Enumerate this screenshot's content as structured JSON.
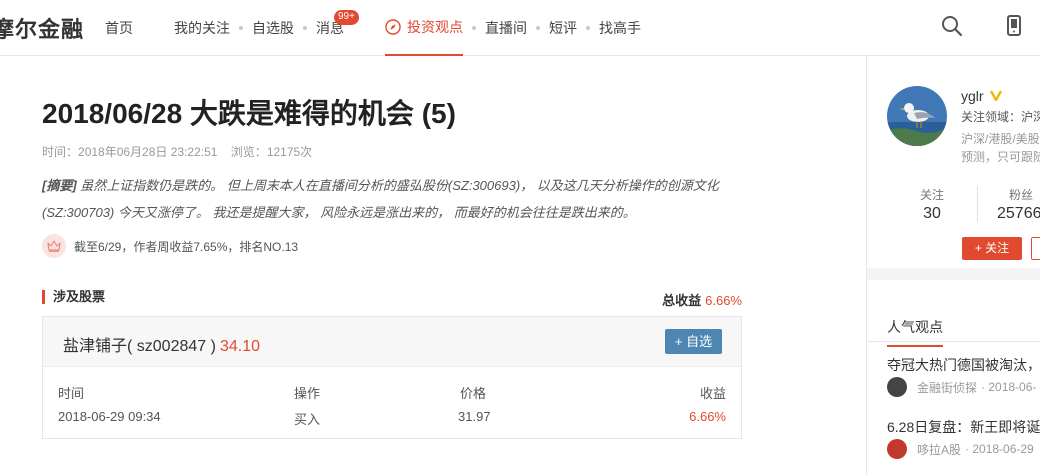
{
  "header": {
    "logo": "摩尔金融",
    "nav": [
      {
        "label": "首页",
        "active": false
      },
      {
        "label": "我的关注",
        "active": false
      },
      {
        "label": "自选股",
        "active": false
      },
      {
        "label": "消息",
        "active": false,
        "badge": "99+"
      },
      {
        "label": "投资观点",
        "active": true,
        "icon": "compass-icon"
      },
      {
        "label": "直播间",
        "active": false
      },
      {
        "label": "短评",
        "active": false
      },
      {
        "label": "找高手",
        "active": false
      }
    ],
    "icons": [
      "search-icon",
      "mobile-phone-icon"
    ]
  },
  "article": {
    "title": "2018/06/28 大跌是难得的机会 (5)",
    "time_label": "时间：",
    "time": "2018年06月28日 23:22:51",
    "views_label": "浏览：",
    "views": "12175次",
    "summary_tag": "[摘要]",
    "summary": " 虽然上证指数仍是跌的。 但上周末本人在直播间分析的盛弘股份(SZ:300693)， 以及这几天分析操作的创源文化(SZ:300703) 今天又涨停了。 我还是提醒大家， 风险永远是涨出来的， 而最好的机会往往是跌出来的。",
    "performance": "截至6/29，作者周收益7.65%，排名NO.13"
  },
  "stocks_section": {
    "title": "涉及股票",
    "total_label": "总收益",
    "total_value": "6.66%",
    "stock": {
      "name": "盐津铺子( sz002847 )",
      "price": "34.10",
      "add_label": "+ 自选"
    },
    "columns": [
      "时间",
      "操作",
      "价格",
      "收益"
    ],
    "rows": [
      {
        "time": "2018-06-29 09:34",
        "action": "买入",
        "price": "31.97",
        "gain": "6.66%"
      }
    ]
  },
  "profile": {
    "username": "yglr",
    "focus_label": "关注领域：",
    "focus_value": "沪深",
    "tags_line1": "沪深/港股/美股",
    "tags_line2": "预测，只可跟随",
    "following_label": "关注",
    "following": "30",
    "fans_label": "粉丝",
    "fans": "25766",
    "follow_btn": "+ 关注"
  },
  "hot": {
    "title": "人气观点",
    "items": [
      {
        "title": "夺冠大热门德国被淘汰，",
        "author": "金融街侦探",
        "date": "· 2018-06-"
      },
      {
        "title": "6.28日复盘：新王即将诞",
        "author": "哆拉A股",
        "date": "· 2018-06-29"
      }
    ]
  },
  "colors": {
    "accent": "#e14a2e",
    "button_blue": "#4d86b1"
  }
}
